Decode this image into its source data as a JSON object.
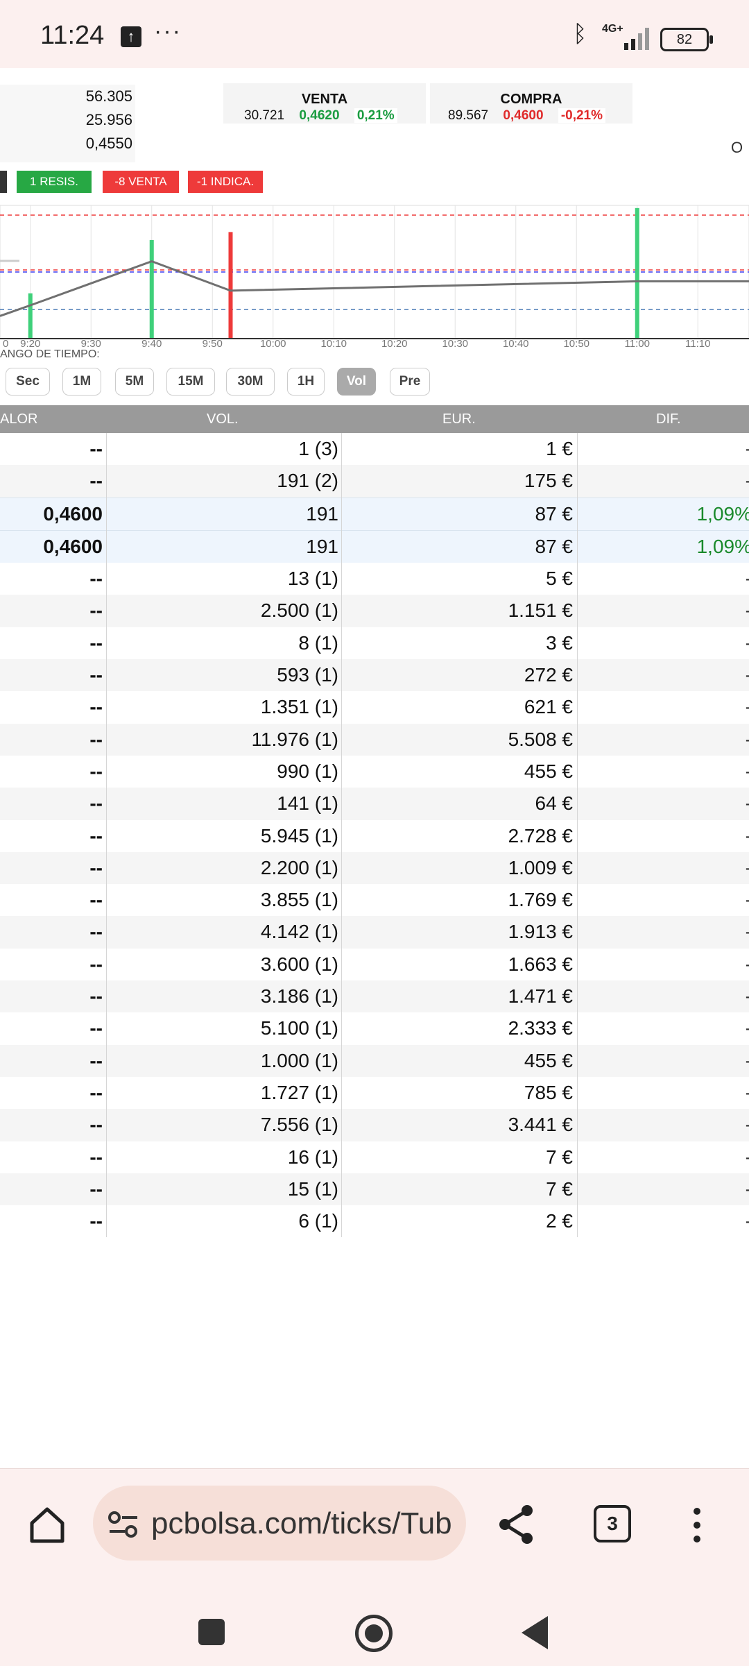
{
  "status_bar": {
    "time": "11:24",
    "network": "4G+",
    "battery": "82"
  },
  "summary": {
    "stats": [
      "56.305",
      "25.956",
      "0,4550"
    ],
    "venta": {
      "title": "VENTA",
      "volume": "30.721",
      "price": "0,4620",
      "change": "0,21%"
    },
    "compra": {
      "title": "COMPRA",
      "volume": "89.567",
      "price": "0,4600",
      "change": "-0,21%"
    },
    "edge_right": "O"
  },
  "badges": {
    "resis": "1 RESIS.",
    "venta": "-8 VENTA",
    "indica": "-1 INDICA."
  },
  "chart": {
    "x_labels": [
      "0",
      "9:20",
      "9:30",
      "9:40",
      "9:50",
      "10:00",
      "10:10",
      "10:20",
      "10:30",
      "10:40",
      "10:50",
      "11:00",
      "11:10"
    ],
    "colors": {
      "buy": "#3fd07a",
      "sell": "#ee3a3a",
      "line": "#707070"
    }
  },
  "chart_data": {
    "type": "line",
    "x": [
      "9:15",
      "9:20",
      "9:40",
      "9:53",
      "11:00",
      "11:20"
    ],
    "y_rel": [
      0.17,
      0.25,
      0.58,
      0.36,
      0.43,
      0.43
    ],
    "volume_bars": [
      {
        "x": "9:20",
        "kind": "buy",
        "height": 0.34
      },
      {
        "x": "9:40",
        "kind": "buy",
        "height": 0.74
      },
      {
        "x": "9:53",
        "kind": "sell",
        "height": 0.8
      },
      {
        "x": "11:00",
        "kind": "buy",
        "height": 0.98
      }
    ]
  },
  "range": {
    "label": "ANGO DE TIEMPO:",
    "buttons": [
      "Sec",
      "1M",
      "5M",
      "15M",
      "30M",
      "1H",
      "Vol",
      "Pre"
    ],
    "active": "Vol"
  },
  "table": {
    "headers": [
      "ALOR",
      "VOL.",
      "EUR.",
      "DIF."
    ],
    "rows": [
      [
        "--",
        "1 (3)",
        "1 €",
        "-"
      ],
      [
        "--",
        "191 (2)",
        "175 €",
        "-"
      ],
      [
        "0,4600",
        "191",
        "87 €",
        "1,09%"
      ],
      [
        "0,4600",
        "191",
        "87 €",
        "1,09%"
      ],
      [
        "--",
        "13 (1)",
        "5 €",
        "-"
      ],
      [
        "--",
        "2.500 (1)",
        "1.151 €",
        "-"
      ],
      [
        "--",
        "8 (1)",
        "3 €",
        "-"
      ],
      [
        "--",
        "593 (1)",
        "272 €",
        "-"
      ],
      [
        "--",
        "1.351 (1)",
        "621 €",
        "-"
      ],
      [
        "--",
        "11.976 (1)",
        "5.508 €",
        "-"
      ],
      [
        "--",
        "990 (1)",
        "455 €",
        "-"
      ],
      [
        "--",
        "141 (1)",
        "64 €",
        "-"
      ],
      [
        "--",
        "5.945 (1)",
        "2.728 €",
        "-"
      ],
      [
        "--",
        "2.200 (1)",
        "1.009 €",
        "-"
      ],
      [
        "--",
        "3.855 (1)",
        "1.769 €",
        "-"
      ],
      [
        "--",
        "4.142 (1)",
        "1.913 €",
        "-"
      ],
      [
        "--",
        "3.600 (1)",
        "1.663 €",
        "-"
      ],
      [
        "--",
        "3.186 (1)",
        "1.471 €",
        "-"
      ],
      [
        "--",
        "5.100 (1)",
        "2.333 €",
        "-"
      ],
      [
        "--",
        "1.000 (1)",
        "455 €",
        "-"
      ],
      [
        "--",
        "1.727 (1)",
        "785 €",
        "-"
      ],
      [
        "--",
        "7.556 (1)",
        "3.441 €",
        "-"
      ],
      [
        "--",
        "16 (1)",
        "7 €",
        "-"
      ],
      [
        "--",
        "15 (1)",
        "7 €",
        "-"
      ],
      [
        "--",
        "6 (1)",
        "2 €",
        "-"
      ]
    ]
  },
  "browser": {
    "url": "pcbolsa.com/ticks/Tub",
    "tab_count": "3"
  }
}
